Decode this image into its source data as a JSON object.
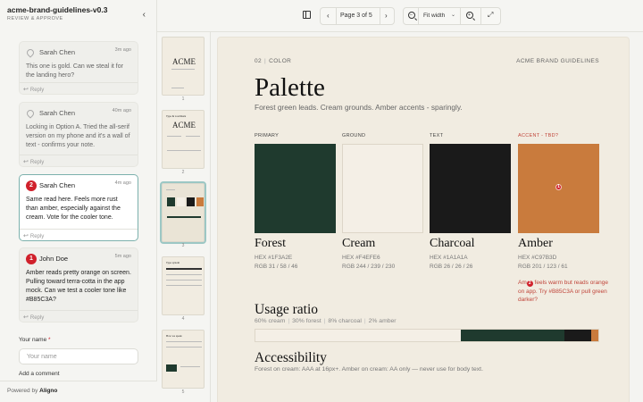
{
  "doc": {
    "title": "acme-brand-guidelines-v0.3",
    "subtitle": "REVIEW & APPROVE"
  },
  "comments": [
    {
      "author": "Sarah Chen",
      "time": "3m ago",
      "text": "This one is gold. Can we steal it for the landing hero?",
      "reply": "Reply",
      "pinned": true
    },
    {
      "author": "Sarah Chen",
      "time": "40m ago",
      "text": "Locking in Option A. Tried the all-serif version on my phone and it's a wall of text - confirms your note.",
      "reply": "Reply",
      "pinned": true
    },
    {
      "author": "Sarah Chen",
      "time": "4m ago",
      "text": "Same read here. Feels more rust than amber, especially against the cream. Vote for the cooler tone.",
      "reply": "Reply",
      "badge": "2",
      "active": true
    },
    {
      "author": "John Doe",
      "time": "5m ago",
      "text": "Amber reads pretty orange on screen. Pulling toward terra-cotta in the app mock. Can we test a cooler tone like #B85C3A?",
      "reply": "Reply",
      "badge": "1"
    }
  ],
  "form": {
    "name_label": "Your name",
    "required_mark": "*",
    "name_placeholder": "Your name",
    "add_comment_label": "Add a comment"
  },
  "footer": {
    "powered_prefix": "Powered by",
    "powered_brand": "Aligno"
  },
  "toolbar": {
    "page_label": "Page 3 of 5",
    "page_current": 3,
    "page_total": 5,
    "zoom_label": "Fit width"
  },
  "thumbnails": [
    {
      "number": "1",
      "mini_title": "ACME"
    },
    {
      "number": "2",
      "mini_title": "ACME",
      "mini_subtitle": "Type & wordmark"
    },
    {
      "number": "3",
      "active": true
    },
    {
      "number": "4",
      "mini_subtitle": "Type system"
    },
    {
      "number": "5",
      "mini_subtitle": "How we speak"
    }
  ],
  "page": {
    "section_number": "02",
    "section_name": "COLOR",
    "brand_label": "ACME BRAND GUIDELINES",
    "title": "Palette",
    "lede": "Forest green leads. Cream grounds. Amber accents - sparingly.",
    "swatches": [
      {
        "label": "PRIMARY",
        "name": "Forest",
        "hex": "HEX  #1F3A2E",
        "rgb": "RGB  31 / 58 / 46",
        "color": "#1f3a2e"
      },
      {
        "label": "GROUND",
        "name": "Cream",
        "hex": "HEX  #F4EFE6",
        "rgb": "RGB  244 / 239 / 230",
        "color": "#f4efe6"
      },
      {
        "label": "TEXT",
        "name": "Charcoal",
        "hex": "HEX  #1A1A1A",
        "rgb": "RGB  26 / 26 / 26",
        "color": "#1a1a1a"
      },
      {
        "label": "ACCENT - TBD?",
        "name": "Amber",
        "hex": "HEX  #C97B3D",
        "rgb": "RGB  201 / 123 / 61",
        "color": "#c97b3d",
        "pin": "1"
      }
    ],
    "amber_note_before": "Am",
    "amber_note_badge": "2",
    "amber_note_after": " feels warm but reads orange on app. Try #B85C3A or pull green darker?",
    "usage": {
      "title": "Usage ratio",
      "parts": [
        {
          "text": "60% cream",
          "percent": 60,
          "color": "#f4efe6"
        },
        {
          "text": "30% forest",
          "percent": 30,
          "color": "#1f3a2e"
        },
        {
          "text": "8% charcoal",
          "percent": 8,
          "color": "#1a1a1a"
        },
        {
          "text": "2% amber",
          "percent": 2,
          "color": "#c97b3d"
        }
      ]
    },
    "accessibility": {
      "title": "Accessibility",
      "text": "Forest on cream: AAA at 16px+. Amber on cream: AA only — never use for body text."
    }
  }
}
